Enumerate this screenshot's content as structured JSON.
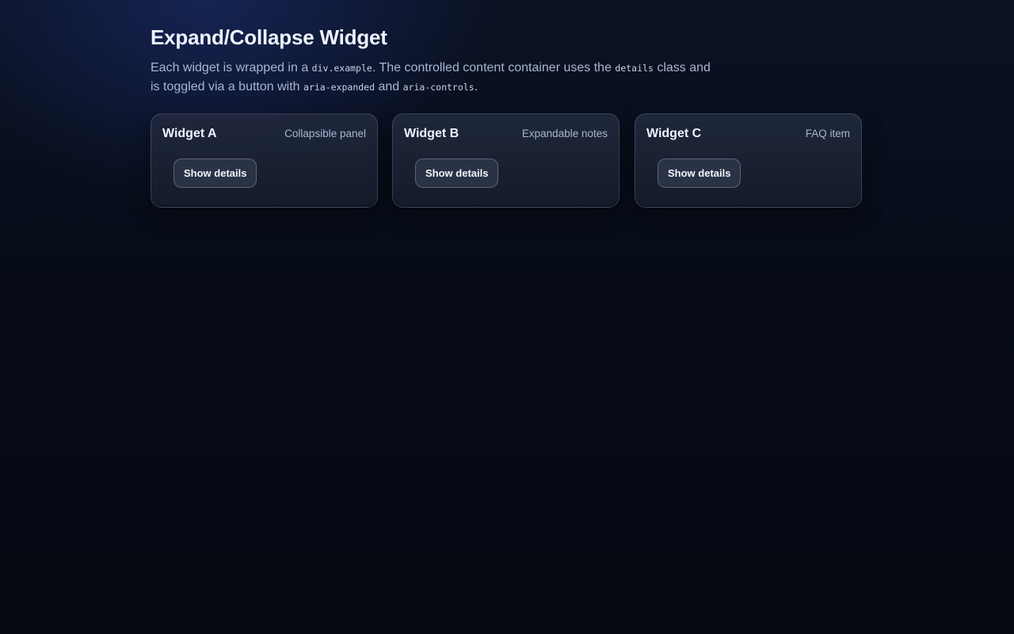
{
  "page": {
    "title": "Expand/Collapse Widget",
    "intro": {
      "t1": "Each widget is wrapped in a ",
      "c1": "div.example",
      "t2": ". The controlled content container uses the ",
      "c2": "details",
      "t3": " class and is toggled via a button with ",
      "c3": "aria-expanded",
      "t4": " and ",
      "c4": "aria-controls",
      "t5": "."
    }
  },
  "widgets": [
    {
      "title": "Widget A",
      "subtitle": "Collapsible panel",
      "button_label": "Show details"
    },
    {
      "title": "Widget B",
      "subtitle": "Expandable notes",
      "button_label": "Show details"
    },
    {
      "title": "Widget C",
      "subtitle": "FAQ item",
      "button_label": "Show details"
    }
  ],
  "colors": {
    "background": "#060b16",
    "card": "#1d2436",
    "text": "#eef3ff",
    "muted": "#a9b6d0"
  }
}
